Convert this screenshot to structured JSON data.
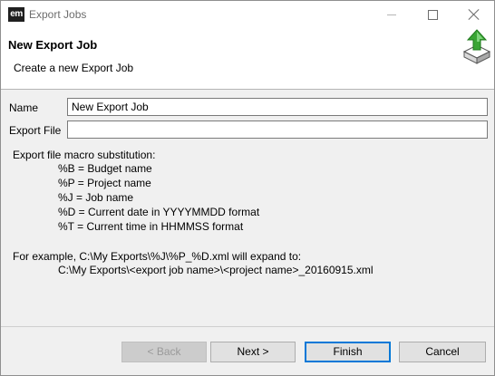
{
  "window": {
    "app_icon_label": "em",
    "title": "Export Jobs",
    "icons": [
      "minimize-icon",
      "maximize-icon",
      "close-icon"
    ]
  },
  "header": {
    "title": "New Export Job",
    "subtitle": "Create a new Export Job",
    "graphic": "export-box-arrow-icon"
  },
  "form": {
    "name_label": "Name",
    "name_value": "New Export Job",
    "file_label": "Export File",
    "file_value": ""
  },
  "help": {
    "intro": "Export file macro substitution:",
    "macros": [
      "%B = Budget name",
      "%P = Project name",
      "%J = Job name",
      "%D = Current date in YYYYMMDD format",
      "%T = Current time in HHMMSS format"
    ],
    "example_intro": "For example, C:\\My Exports\\%J\\%P_%D.xml will expand to:",
    "example_result": "C:\\My Exports\\<export job name>\\<project name>_20160915.xml"
  },
  "buttons": {
    "back": "< Back",
    "next": "Next >",
    "finish": "Finish",
    "cancel": "Cancel"
  },
  "colors": {
    "default_button_border": "#0078d7",
    "arrow_green": "#3aa535"
  }
}
